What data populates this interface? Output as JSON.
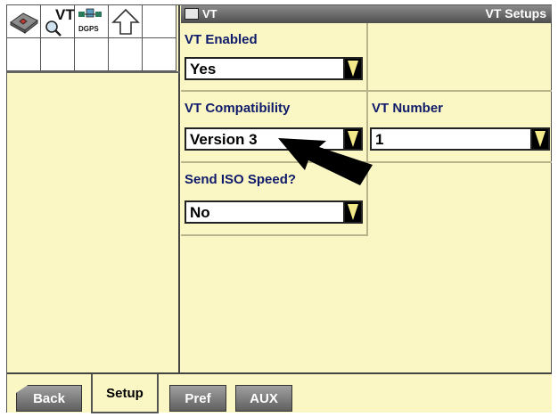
{
  "title_bar": {
    "left_title": "VT",
    "right_title": "VT Setups"
  },
  "left_panel": {
    "icons": [
      "book-diamond-icon",
      "vt-magnifier-icon",
      "dgps-icon",
      "up-arrow-icon"
    ],
    "vt_icon_text": "VT",
    "dgps_icon_text": "DGPS"
  },
  "fields": {
    "vt_enabled": {
      "label": "VT Enabled",
      "value": "Yes"
    },
    "vt_compatibility": {
      "label": "VT Compatibility",
      "value": "Version 3"
    },
    "vt_number": {
      "label": "VT Number",
      "value": "1"
    },
    "send_iso_speed": {
      "label": "Send ISO Speed?",
      "value": "No"
    }
  },
  "tabs": {
    "back": "Back",
    "setup": "Setup",
    "pref": "Pref",
    "aux": "AUX",
    "active": "Setup"
  },
  "colors": {
    "panel_background": "#fbf7c5",
    "label_text": "#0f1b6a",
    "dropdown_arrow": "#f3e98a"
  }
}
